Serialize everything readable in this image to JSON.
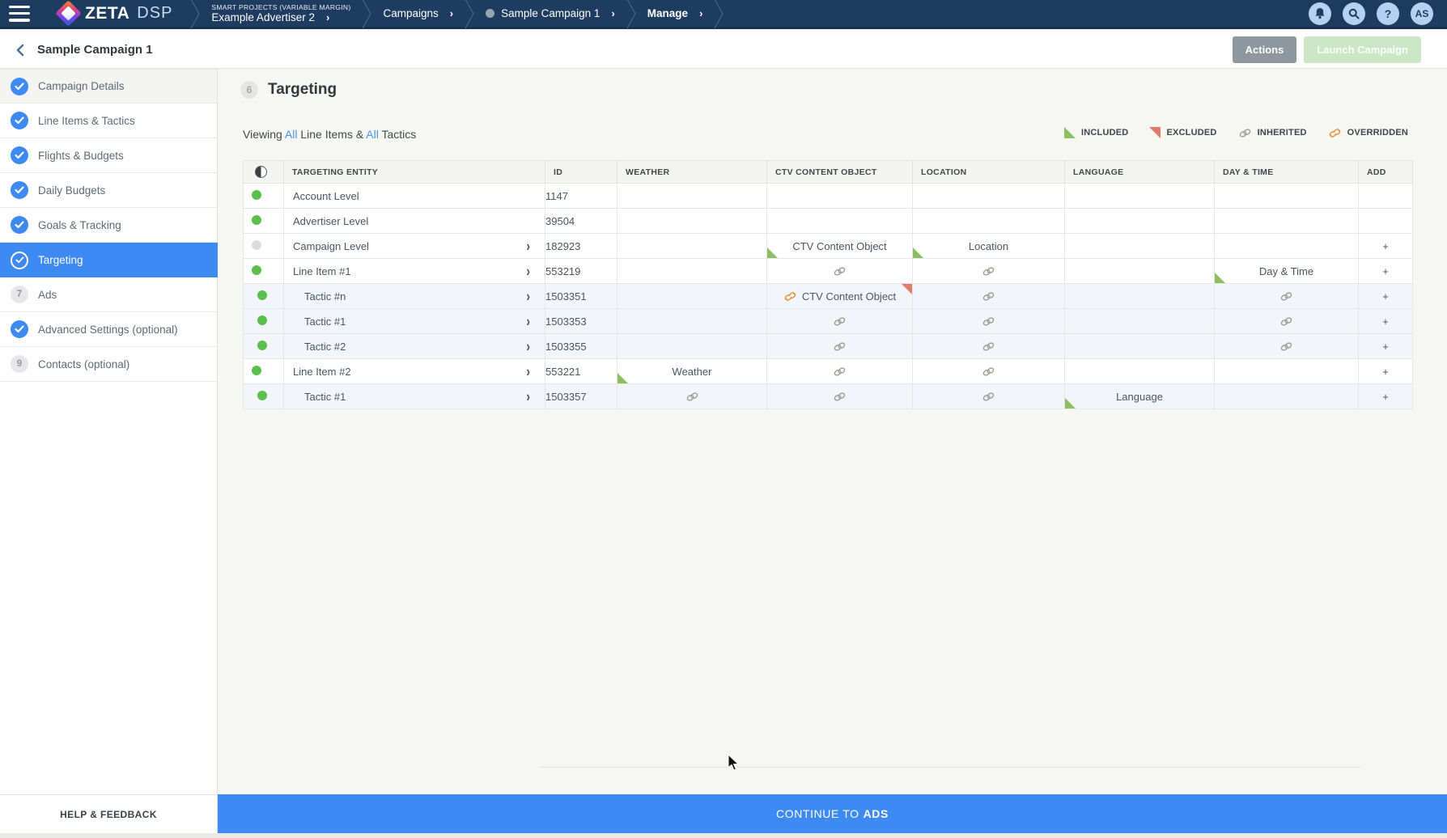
{
  "topbar": {
    "brand_zeta": "ZETA",
    "brand_dsp": "DSP",
    "breadcrumb": [
      {
        "sup": "SMART PROJECTS (VARIABLE MARGIN)",
        "label": "Example Advertiser 2",
        "dot": false,
        "bold": false
      },
      {
        "sup": "",
        "label": "Campaigns",
        "dot": false,
        "bold": false
      },
      {
        "sup": "",
        "label": "Sample Campaign 1",
        "dot": true,
        "bold": false
      },
      {
        "sup": "",
        "label": "Manage",
        "dot": false,
        "bold": true
      }
    ],
    "help_glyph": "?",
    "avatar_initials": "AS"
  },
  "page_header": {
    "title": "Sample Campaign 1",
    "actions_label": "Actions",
    "launch_label": "Launch Campaign"
  },
  "sidebar": {
    "items": [
      {
        "label": "Campaign Details",
        "state": "done",
        "number": ""
      },
      {
        "label": "Line Items & Tactics",
        "state": "done",
        "number": ""
      },
      {
        "label": "Flights & Budgets",
        "state": "done",
        "number": ""
      },
      {
        "label": "Daily Budgets",
        "state": "done",
        "number": ""
      },
      {
        "label": "Goals & Tracking",
        "state": "done",
        "number": ""
      },
      {
        "label": "Targeting",
        "state": "active",
        "number": ""
      },
      {
        "label": "Ads",
        "state": "todo",
        "number": "7"
      },
      {
        "label": "Advanced Settings (optional)",
        "state": "done",
        "number": ""
      },
      {
        "label": "Contacts (optional)",
        "state": "todo",
        "number": "9"
      }
    ],
    "help_label": "HELP & FEEDBACK"
  },
  "main": {
    "step_number": "6",
    "title": "Targeting",
    "viewing": {
      "prefix": "Viewing ",
      "all1": "All",
      "mid": " Line Items & ",
      "all2": "All",
      "suffix": " Tactics"
    },
    "legend": [
      {
        "icon": "included-triangle",
        "label": "INCLUDED"
      },
      {
        "icon": "excluded-triangle",
        "label": "EXCLUDED"
      },
      {
        "icon": "inherited-chain",
        "label": "INHERITED"
      },
      {
        "icon": "overridden-chain",
        "label": "OVERRIDDEN"
      }
    ],
    "table": {
      "columns": [
        "",
        "TARGETING ENTITY",
        "ID",
        "WEATHER",
        "CTV CONTENT OBJECT",
        "LOCATION",
        "LANGUAGE",
        "DAY & TIME",
        "ADD"
      ],
      "rows": [
        {
          "entity": "Account Level",
          "id": "1147",
          "dot": "green",
          "tactic": false,
          "chevron": false,
          "add": false,
          "cells": {}
        },
        {
          "entity": "Advertiser Level",
          "id": "39504",
          "dot": "green",
          "tactic": false,
          "chevron": false,
          "add": false,
          "cells": {}
        },
        {
          "entity": "Campaign Level",
          "id": "182923",
          "dot": "gray",
          "tactic": false,
          "chevron": true,
          "add": true,
          "cells": {
            "ctv": {
              "text": "CTV Content Object",
              "included": true
            },
            "location": {
              "text": "Location",
              "included": true
            }
          }
        },
        {
          "entity": "Line Item #1",
          "id": "553219",
          "dot": "green",
          "tactic": false,
          "chevron": true,
          "add": true,
          "cells": {
            "ctv": {
              "icon": "chain"
            },
            "location": {
              "icon": "chain"
            },
            "daytime": {
              "text": "Day & Time",
              "included": true
            }
          }
        },
        {
          "entity": "Tactic #n",
          "id": "1503351",
          "dot": "green",
          "tactic": true,
          "chevron": true,
          "add": true,
          "cells": {
            "ctv": {
              "text": "CTV Content Object",
              "icon": "broken",
              "excluded": true
            },
            "location": {
              "icon": "chain"
            },
            "daytime": {
              "icon": "chain"
            }
          }
        },
        {
          "entity": "Tactic #1",
          "id": "1503353",
          "dot": "green",
          "tactic": true,
          "chevron": true,
          "add": true,
          "cells": {
            "ctv": {
              "icon": "chain"
            },
            "location": {
              "icon": "chain"
            },
            "daytime": {
              "icon": "chain"
            }
          }
        },
        {
          "entity": "Tactic #2",
          "id": "1503355",
          "dot": "green",
          "tactic": true,
          "chevron": true,
          "add": true,
          "cells": {
            "ctv": {
              "icon": "chain"
            },
            "location": {
              "icon": "chain"
            },
            "daytime": {
              "icon": "chain"
            }
          }
        },
        {
          "entity": "Line Item #2",
          "id": "553221",
          "dot": "green",
          "tactic": false,
          "chevron": true,
          "add": true,
          "cells": {
            "weather": {
              "text": "Weather",
              "included": true
            },
            "ctv": {
              "icon": "chain"
            },
            "location": {
              "icon": "chain"
            }
          }
        },
        {
          "entity": "Tactic #1",
          "id": "1503357",
          "dot": "green",
          "tactic": true,
          "chevron": true,
          "add": true,
          "cells": {
            "weather": {
              "icon": "chain"
            },
            "ctv": {
              "icon": "chain"
            },
            "location": {
              "icon": "chain"
            },
            "language": {
              "text": "Language",
              "included": true
            }
          }
        }
      ]
    }
  },
  "footer": {
    "continue_prefix": "CONTINUE TO",
    "continue_bold": "ADS"
  },
  "colors": {
    "topbar": "#1e3c60",
    "accent_blue": "#3d8af2",
    "link_blue": "#4596e8",
    "included_green": "#8cbf62",
    "excluded_red": "#e07b6b",
    "status_green": "#5bbf4e",
    "inherited_gray": "#a39d95",
    "overridden_orange": "#e8923c",
    "launch_green": "#cbe7c5",
    "actions_gray": "#8e969e"
  }
}
